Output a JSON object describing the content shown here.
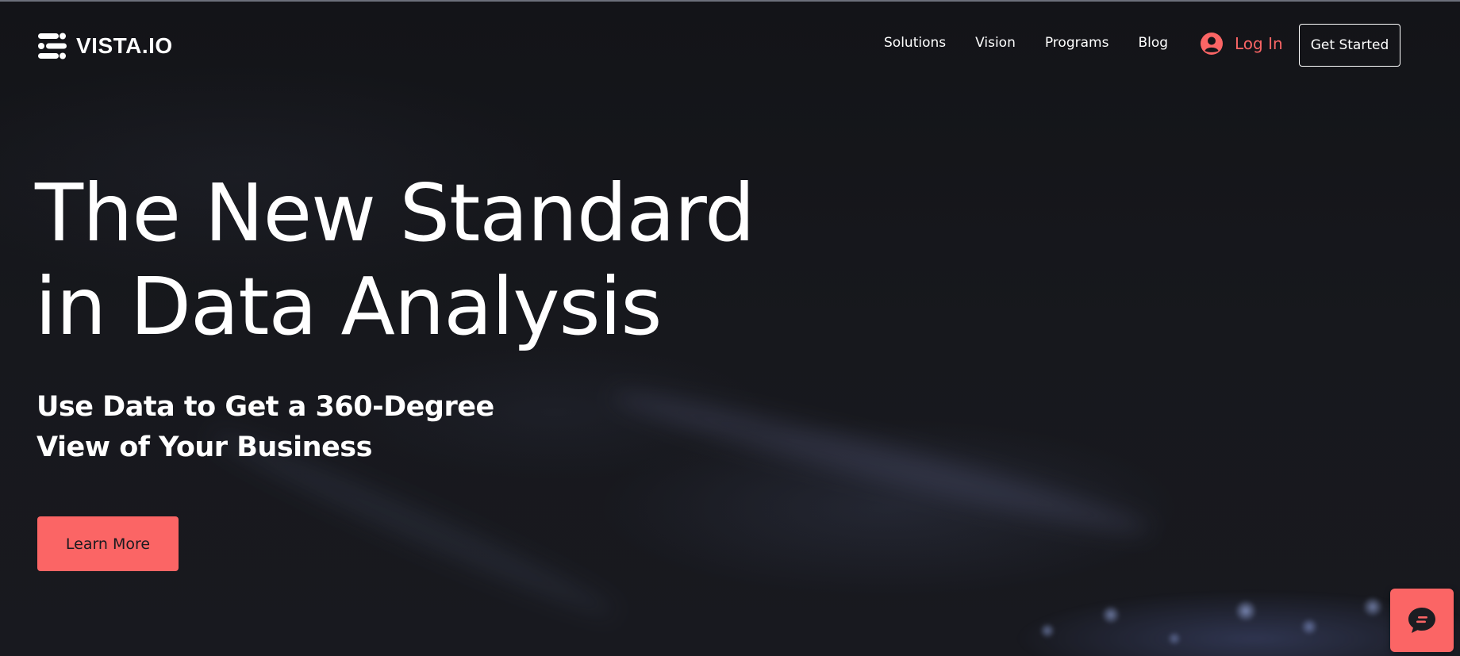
{
  "brand": {
    "name": "VISTA.IO",
    "logo_icon": "vista-logo-icon"
  },
  "nav": {
    "items": [
      {
        "label": "Solutions"
      },
      {
        "label": "Vision"
      },
      {
        "label": "Programs"
      },
      {
        "label": "Blog"
      }
    ]
  },
  "auth": {
    "login_label": "Log In",
    "login_icon": "user-avatar-icon",
    "get_started_label": "Get Started"
  },
  "hero": {
    "title_line1": "The New Standard",
    "title_line2": "in Data Analysis",
    "subtitle_line1": "Use Data to Get a 360-Degree",
    "subtitle_line2": "View of Your Business",
    "cta_label": "Learn More"
  },
  "chat": {
    "icon": "chat-bubble-icon"
  },
  "colors": {
    "background": "#141519",
    "accent": "#fb6565",
    "text": "#ffffff"
  }
}
